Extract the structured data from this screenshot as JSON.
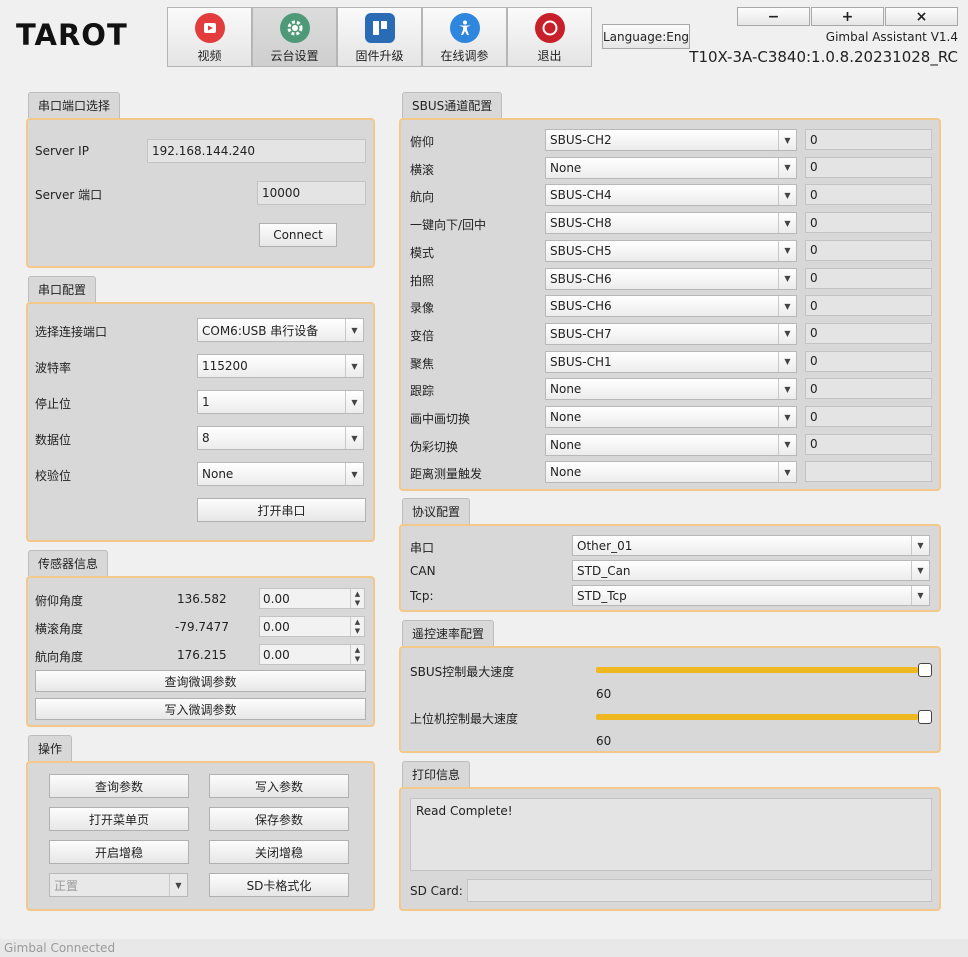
{
  "header": {
    "logo": "TAROT",
    "nav": [
      {
        "label": "视频"
      },
      {
        "label": "云台设置"
      },
      {
        "label": "固件升级"
      },
      {
        "label": "在线调参"
      },
      {
        "label": "退出"
      }
    ],
    "language": "Language:Eng",
    "app_title": "Gimbal Assistant V1.4",
    "fw_version": "T10X-3A-C3840:1.0.8.20231028_RC",
    "win_minimize": "−",
    "win_maximize": "+",
    "win_close": "×"
  },
  "server": {
    "title": "串口端口选择",
    "ip_label": "Server IP",
    "ip_value": "192.168.144.240",
    "port_label": "Server 端口",
    "port_value": "10000",
    "connect": "Connect"
  },
  "serial": {
    "title": "串口配置",
    "rows": [
      {
        "label": "选择连接端口",
        "value": "COM6:USB 串行设备"
      },
      {
        "label": "波特率",
        "value": "115200"
      },
      {
        "label": "停止位",
        "value": "1"
      },
      {
        "label": "数据位",
        "value": "8"
      },
      {
        "label": "校验位",
        "value": "None"
      }
    ],
    "open": "打开串口"
  },
  "sensor": {
    "title": "传感器信息",
    "rows": [
      {
        "label": "俯仰角度",
        "reading": "136.582",
        "adjust": "0.00"
      },
      {
        "label": "横滚角度",
        "reading": "-79.7477",
        "adjust": "0.00"
      },
      {
        "label": "航向角度",
        "reading": "176.215",
        "adjust": "0.00"
      }
    ],
    "query": "查询微调参数",
    "write": "写入微调参数"
  },
  "ops": {
    "title": "操作",
    "query_params": "查询参数",
    "write_params": "写入参数",
    "open_menu": "打开菜单页",
    "save_params": "保存参数",
    "enable_stab": "开启增稳",
    "disable_stab": "关闭增稳",
    "mount_value": "正置",
    "sd_format": "SD卡格式化"
  },
  "sbus": {
    "title": "SBUS通道配置",
    "rows": [
      {
        "label": "俯仰",
        "channel": "SBUS-CH2",
        "value": "0"
      },
      {
        "label": "横滚",
        "channel": "None",
        "value": "0"
      },
      {
        "label": "航向",
        "channel": "SBUS-CH4",
        "value": "0"
      },
      {
        "label": "一键向下/回中",
        "channel": "SBUS-CH8",
        "value": "0"
      },
      {
        "label": "模式",
        "channel": "SBUS-CH5",
        "value": "0"
      },
      {
        "label": "拍照",
        "channel": "SBUS-CH6",
        "value": "0"
      },
      {
        "label": "录像",
        "channel": "SBUS-CH6",
        "value": "0"
      },
      {
        "label": "变倍",
        "channel": "SBUS-CH7",
        "value": "0"
      },
      {
        "label": "聚焦",
        "channel": "SBUS-CH1",
        "value": "0"
      },
      {
        "label": "跟踪",
        "channel": "None",
        "value": "0"
      },
      {
        "label": "画中画切换",
        "channel": "None",
        "value": "0"
      },
      {
        "label": "伪彩切换",
        "channel": "None",
        "value": "0"
      },
      {
        "label": "距离测量触发",
        "channel": "None",
        "value": ""
      }
    ]
  },
  "protocol": {
    "title": "协议配置",
    "rows": [
      {
        "label": "串口",
        "value": "Other_01"
      },
      {
        "label": "CAN",
        "value": "STD_Can"
      },
      {
        "label": "Tcp:",
        "value": "STD_Tcp"
      }
    ]
  },
  "speed": {
    "title": "遥控速率配置",
    "sbus_label": "SBUS控制最大速度",
    "sbus_value": "60",
    "sbus_fraction": 1.0,
    "host_label": "上位机控制最大速度",
    "host_value": "60",
    "host_fraction": 1.0
  },
  "print": {
    "title": "打印信息",
    "log": "Read Complete!",
    "sd_label": "SD Card:",
    "sd_value": ""
  },
  "status_text": "Gimbal Connected",
  "colors": {
    "accent_border": "#f2c98a",
    "slider": "#f0b820"
  }
}
